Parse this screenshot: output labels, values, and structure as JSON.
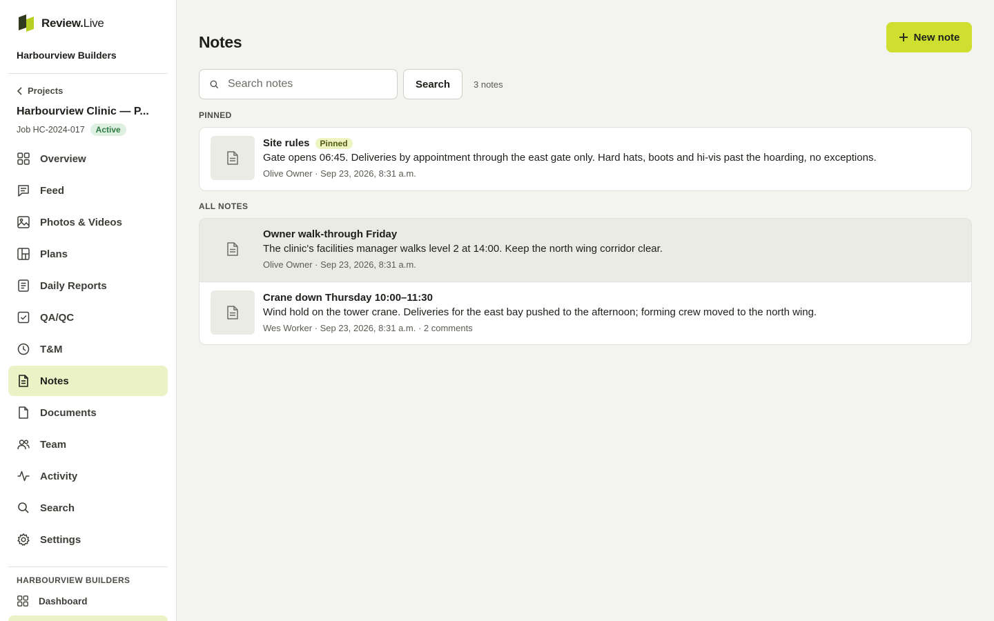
{
  "brand": {
    "name_bold": "Review.",
    "name_light": "Live"
  },
  "org_name": "Harbourview Builders",
  "back_link": "Projects",
  "project": {
    "name": "Harbourview Clinic — P...",
    "job": "Job HC-2024-017",
    "status": "Active"
  },
  "nav": [
    {
      "label": "Overview",
      "icon": "grid-icon"
    },
    {
      "label": "Feed",
      "icon": "chat-icon"
    },
    {
      "label": "Photos & Videos",
      "icon": "image-icon"
    },
    {
      "label": "Plans",
      "icon": "plans-icon"
    },
    {
      "label": "Daily Reports",
      "icon": "report-icon"
    },
    {
      "label": "QA/QC",
      "icon": "checkbox-icon"
    },
    {
      "label": "T&M",
      "icon": "clock-icon"
    },
    {
      "label": "Notes",
      "icon": "note-icon",
      "active": true
    },
    {
      "label": "Documents",
      "icon": "file-icon"
    },
    {
      "label": "Team",
      "icon": "users-icon"
    },
    {
      "label": "Activity",
      "icon": "activity-icon"
    },
    {
      "label": "Search",
      "icon": "search-icon"
    },
    {
      "label": "Settings",
      "icon": "gear-icon"
    }
  ],
  "org_section": {
    "label": "HARBOURVIEW BUILDERS",
    "dashboard": "Dashboard"
  },
  "page": {
    "title": "Notes",
    "new_note_label": "New note",
    "search_placeholder": "Search notes",
    "search_button": "Search",
    "count": "3 notes"
  },
  "pinned": {
    "label": "PINNED",
    "notes": [
      {
        "title": "Site rules",
        "badge": "Pinned",
        "text": "Gate opens 06:45. Deliveries by appointment through the east gate only. Hard hats, boots and hi-vis past the hoarding, no exceptions.",
        "meta": "Olive Owner · Sep 23, 2026, 8:31 a.m."
      }
    ]
  },
  "all_notes": {
    "label": "ALL NOTES",
    "notes": [
      {
        "title": "Owner walk-through Friday",
        "text": "The clinic's facilities manager walks level 2 at 14:00. Keep the north wing corridor clear.",
        "meta": "Olive Owner · Sep 23, 2026, 8:31 a.m."
      },
      {
        "title": "Crane down Thursday 10:00–11:30",
        "text": "Wind hold on the tower crane. Deliveries for the east bay pushed to the afternoon; forming crew moved to the north wing.",
        "meta": "Wes Worker · Sep 23, 2026, 8:31 a.m. · 2 comments"
      }
    ]
  },
  "colors": {
    "accent": "#cfdf2f",
    "active_nav": "#eaf2c6",
    "status_green": "#2e7a43"
  }
}
